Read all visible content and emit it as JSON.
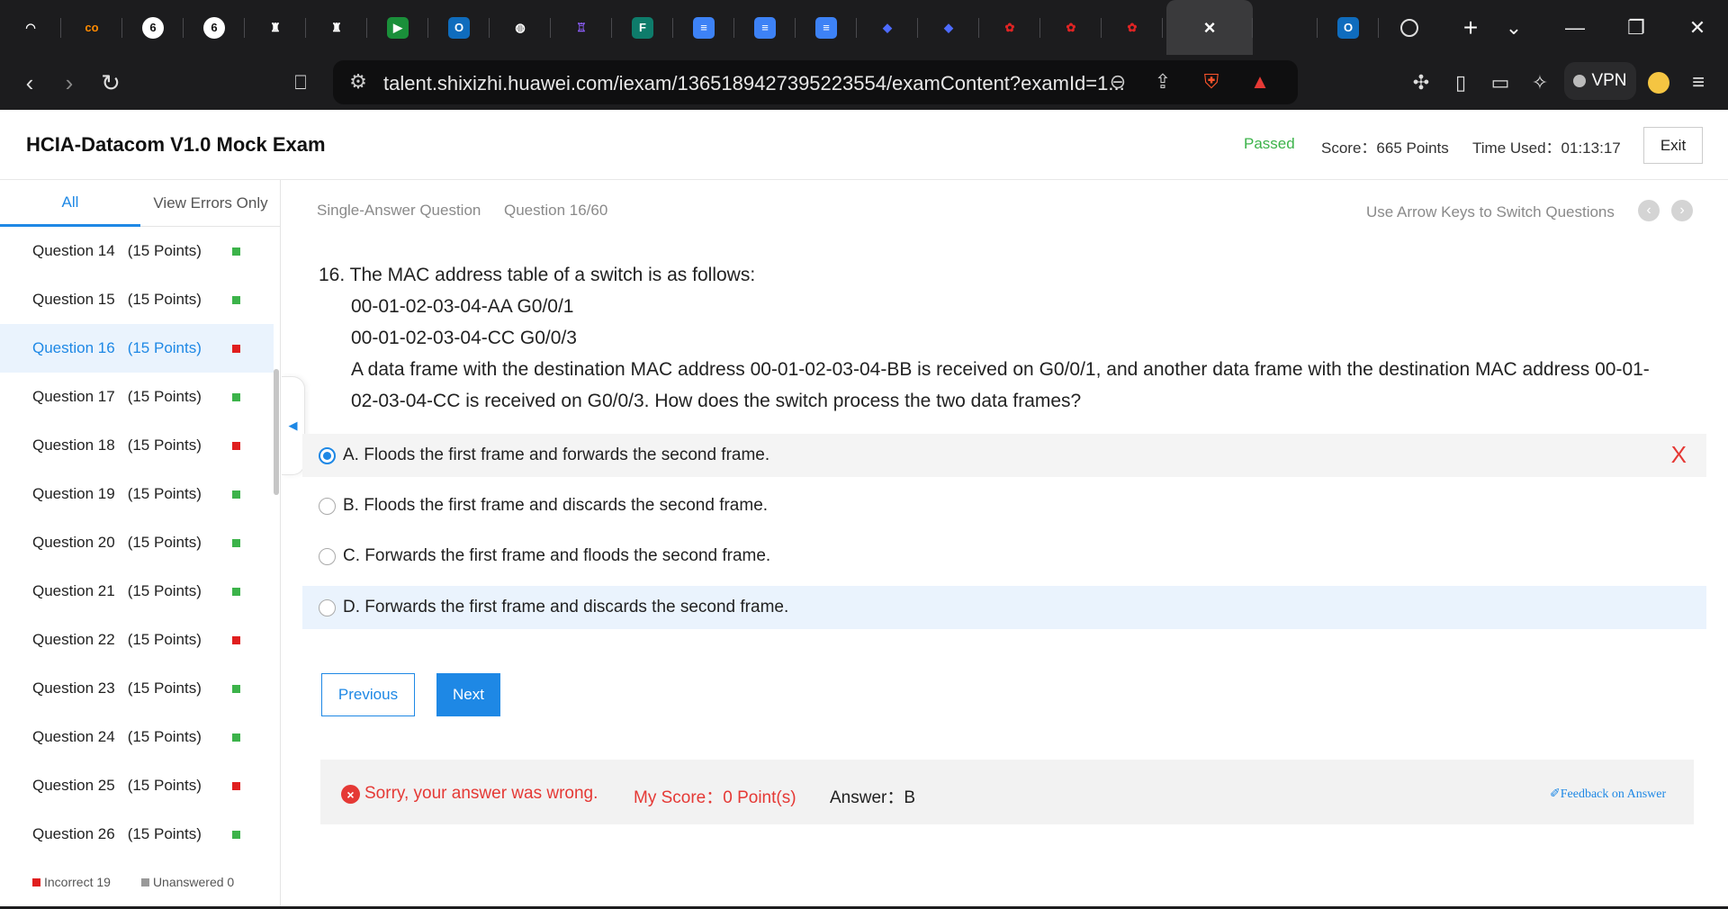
{
  "browser": {
    "tabs": [
      {
        "icon": "speedometer-icon",
        "glyph": "◠",
        "bg": "transparent"
      },
      {
        "icon": "copilot-icon",
        "glyph": "co",
        "bg": "transparent"
      },
      {
        "icon": "six-icon",
        "glyph": "6",
        "bg": "#ffffff"
      },
      {
        "icon": "six-icon",
        "glyph": "6",
        "bg": "#ffffff"
      },
      {
        "icon": "crest-icon",
        "glyph": "♜",
        "bg": "transparent"
      },
      {
        "icon": "crest-icon",
        "glyph": "♜",
        "bg": "transparent"
      },
      {
        "icon": "meet-icon",
        "glyph": "▶",
        "bg": "#1a8f3a"
      },
      {
        "icon": "outlook-icon",
        "glyph": "O",
        "bg": "#0f6cbd"
      },
      {
        "icon": "globe-icon",
        "glyph": "◍",
        "bg": "transparent"
      },
      {
        "icon": "castle-icon",
        "glyph": "♖",
        "bg": "transparent"
      },
      {
        "icon": "forms-icon",
        "glyph": "F",
        "bg": "#0e7c6b"
      },
      {
        "icon": "docs-icon",
        "glyph": "≡",
        "bg": "#3d82f6"
      },
      {
        "icon": "docs-icon",
        "glyph": "≡",
        "bg": "#3d82f6"
      },
      {
        "icon": "docs-icon",
        "glyph": "≡",
        "bg": "#3d82f6"
      },
      {
        "icon": "deepseek-icon",
        "glyph": "◆",
        "bg": "transparent"
      },
      {
        "icon": "deepseek-icon",
        "glyph": "◆",
        "bg": "transparent"
      },
      {
        "icon": "huawei-icon",
        "glyph": "✿",
        "bg": "transparent"
      },
      {
        "icon": "huawei-icon",
        "glyph": "✿",
        "bg": "transparent"
      },
      {
        "icon": "huawei-icon",
        "glyph": "✿",
        "bg": "transparent"
      }
    ],
    "active_tab_close": "×",
    "url": "talent.shixizhi.huawei.com/iexam/1365189427395223554/examContent?examId=1..."
  },
  "header": {
    "title": "HCIA-Datacom V1.0 Mock Exam",
    "status": "Passed",
    "score": "Score：665 Points",
    "time_used": "Time Used：01:13:17",
    "exit_label": "Exit"
  },
  "sidebar": {
    "tab_all": "All",
    "tab_errors": "View Errors Only",
    "items": [
      {
        "label": "Question 14",
        "points": "(15 Points)",
        "state": "correct"
      },
      {
        "label": "Question 15",
        "points": "(15 Points)",
        "state": "correct"
      },
      {
        "label": "Question 16",
        "points": "(15 Points)",
        "state": "incorrect",
        "current": true
      },
      {
        "label": "Question 17",
        "points": "(15 Points)",
        "state": "correct"
      },
      {
        "label": "Question 18",
        "points": "(15 Points)",
        "state": "incorrect"
      },
      {
        "label": "Question 19",
        "points": "(15 Points)",
        "state": "correct"
      },
      {
        "label": "Question 20",
        "points": "(15 Points)",
        "state": "correct"
      },
      {
        "label": "Question 21",
        "points": "(15 Points)",
        "state": "correct"
      },
      {
        "label": "Question 22",
        "points": "(15 Points)",
        "state": "incorrect"
      },
      {
        "label": "Question 23",
        "points": "(15 Points)",
        "state": "correct"
      },
      {
        "label": "Question 24",
        "points": "(15 Points)",
        "state": "correct"
      },
      {
        "label": "Question 25",
        "points": "(15 Points)",
        "state": "incorrect"
      },
      {
        "label": "Question 26",
        "points": "(15 Points)",
        "state": "correct"
      }
    ],
    "legend_incorrect": "Incorrect 19",
    "legend_unanswered": "Unanswered 0",
    "colors": {
      "correct": "#3cb34a",
      "incorrect": "#e01e1e",
      "unanswered": "#999999"
    }
  },
  "question": {
    "type": "Single-Answer Question",
    "number": "Question 16/60",
    "arrow_hint": "Use Arrow Keys to Switch Questions",
    "stem_intro": "16. The MAC address table of a switch is as follows:",
    "stem_line1": "00-01-02-03-04-AA G0/0/1",
    "stem_line2": "00-01-02-03-04-CC G0/0/3",
    "stem_body": "A data frame with the destination MAC address 00-01-02-03-04-BB is received on G0/0/1, and another data frame with the destination MAC address 00-01-02-03-04-CC is received on G0/0/3. How does the switch process the two data frames?",
    "options": [
      {
        "text": "A. Floods the first frame and forwards the second frame.",
        "selected": true,
        "wrong": true
      },
      {
        "text": "B. Floods the first frame and discards the second frame.",
        "selected": false
      },
      {
        "text": "C. Forwards the first frame and floods the second frame.",
        "selected": false
      },
      {
        "text": "D. Forwards the first frame and discards the second frame.",
        "selected": false
      }
    ],
    "wrong_mark": "X"
  },
  "buttons": {
    "previous": "Previous",
    "next": "Next"
  },
  "result": {
    "message": "Sorry, your answer was wrong.",
    "my_score": "My Score：0 Point(s)",
    "answer": "Answer：B",
    "feedback": "✐Feedback on Answer"
  }
}
